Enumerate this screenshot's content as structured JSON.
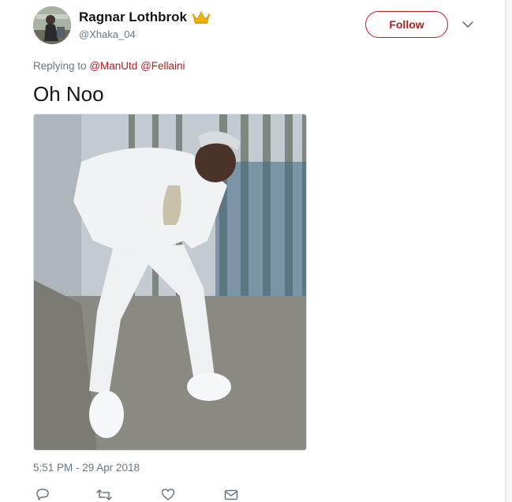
{
  "tweet": {
    "author": {
      "display_name": "Ragnar Lothbrok",
      "handle": "@Xhaka_04",
      "badge_icon": "crown-icon"
    },
    "follow_label": "Follow",
    "replying_prefix": "Replying to",
    "replying_to": [
      "@ManUtd",
      "@Fellaini"
    ],
    "text": "Oh Noo",
    "media_description_icon": "photo",
    "timestamp": "5:51 PM - 29 Apr 2018",
    "actions": [
      "reply-icon",
      "retweet-icon",
      "like-icon",
      "message-icon"
    ]
  },
  "colors": {
    "accent": "#b71c1c",
    "muted_text": "#657786",
    "primary_text": "#14171a"
  }
}
